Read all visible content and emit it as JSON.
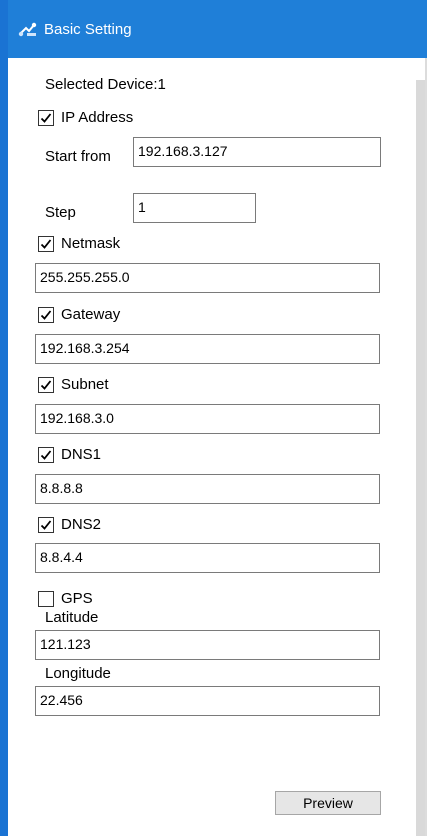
{
  "window": {
    "title": "Basic Setting",
    "icon": "network-settings-icon"
  },
  "form": {
    "selected_device": "Selected Device:1",
    "ip_address": {
      "label": "IP Address",
      "checked": true
    },
    "start_from": {
      "label": "Start from",
      "value": "192.168.3.127"
    },
    "step": {
      "label": "Step",
      "value": "1"
    },
    "netmask": {
      "label": "Netmask",
      "checked": true,
      "value": "255.255.255.0"
    },
    "gateway": {
      "label": "Gateway",
      "checked": true,
      "value": "192.168.3.254"
    },
    "subnet": {
      "label": "Subnet",
      "checked": true,
      "value": "192.168.3.0"
    },
    "dns1": {
      "label": "DNS1",
      "checked": true,
      "value": "8.8.8.8"
    },
    "dns2": {
      "label": "DNS2",
      "checked": true,
      "value": "8.8.4.4"
    },
    "gps": {
      "label": "GPS",
      "checked": false
    },
    "latitude": {
      "label": "Latitude",
      "value": "121.123"
    },
    "longitude": {
      "label": "Longitude",
      "value": "22.456"
    },
    "preview_label": "Preview"
  },
  "colors": {
    "titlebar": "#1f7fd8",
    "border_accent": "#1a73d3"
  }
}
